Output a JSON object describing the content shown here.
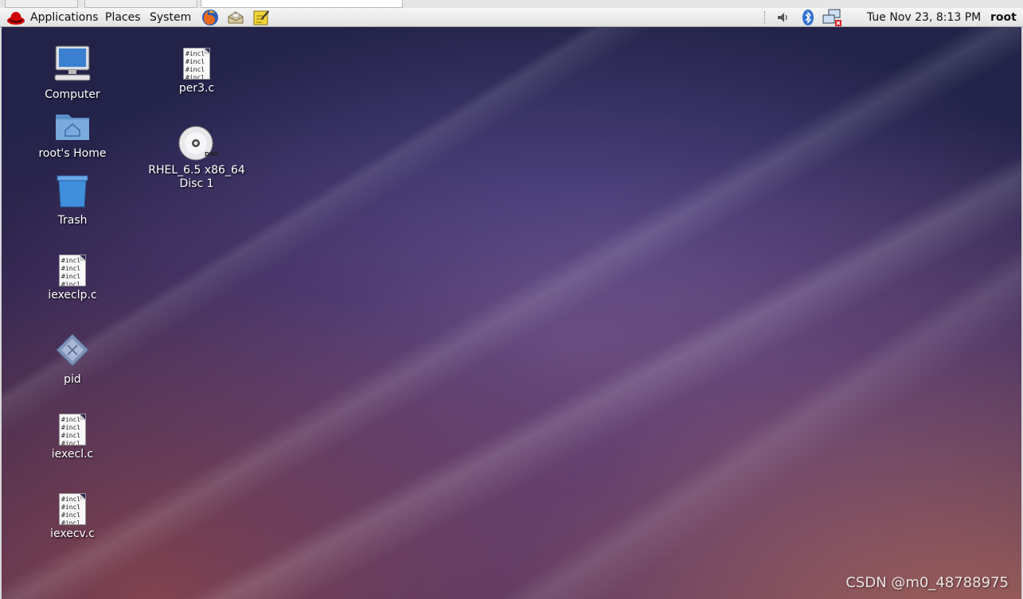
{
  "panel": {
    "menus": [
      "Applications",
      "Places",
      "System"
    ],
    "launchers": [
      "firefox-icon",
      "mail-icon",
      "notes-icon"
    ],
    "tray": [
      "volume-icon",
      "bluetooth-icon",
      "network-disconnected-icon"
    ],
    "clock": "Tue Nov 23,  8:13 PM",
    "user": "root"
  },
  "desktop": {
    "icons": {
      "computer": "Computer",
      "home": "root's Home",
      "trash": "Trash",
      "iexeclp": "iexeclp.c",
      "pid": "pid",
      "iexecl": "iexecl.c",
      "iexecv": "iexecv.c",
      "per3": "per3.c",
      "dvd_line1": "RHEL_6.5 x86_64",
      "dvd_line2": "Disc 1"
    },
    "file_preview_line": "#incl",
    "dvd_badge": "DVD"
  },
  "watermark": "CSDN @m0_48788975",
  "colors": {
    "panel": "#e8e8e8",
    "folder": "#6f9fd8",
    "trash": "#3f8fdc"
  }
}
